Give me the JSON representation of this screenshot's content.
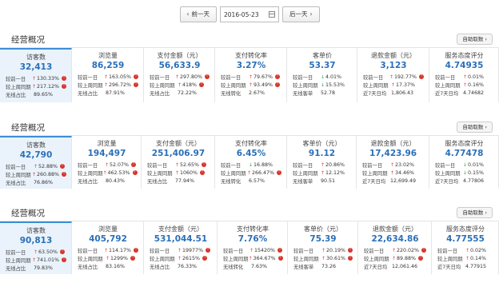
{
  "datebar": {
    "prev_label": "前一天",
    "date_value": "2016-05-23",
    "next_label": "后一天"
  },
  "sections": [
    {
      "title": "经营概况",
      "detail_label": "自助取数",
      "cards": [
        {
          "label": "访客数",
          "value": "32,413",
          "r1k": "较前一日",
          "r1v": "130.33%",
          "r1d": "up",
          "r1b": true,
          "r2k": "较上周同期",
          "r2v": "217.12%",
          "r2d": "up",
          "r2b": true,
          "r3k": "无线占比",
          "r3v": "89.65%"
        },
        {
          "label": "浏览量",
          "value": "86,259",
          "r1k": "较前一日",
          "r1v": "163.05%",
          "r1d": "up",
          "r1b": true,
          "r2k": "较上周同期",
          "r2v": "296.72%",
          "r2d": "up",
          "r2b": true,
          "r3k": "无线占比",
          "r3v": "87.91%"
        },
        {
          "label": "支付金额（元）",
          "value": "56,633.9",
          "r1k": "较前一日",
          "r1v": "297.80%",
          "r1d": "up",
          "r1b": true,
          "r2k": "较上周同期",
          "r2v": "418%",
          "r2d": "up",
          "r2b": true,
          "r3k": "无线占比",
          "r3v": "72.22%"
        },
        {
          "label": "支付转化率",
          "value": "3.27%",
          "r1k": "较前一日",
          "r1v": "79.67%",
          "r1d": "up",
          "r1b": true,
          "r2k": "较上周同期",
          "r2v": "93.49%",
          "r2d": "up",
          "r2b": true,
          "r3k": "无线转化",
          "r3v": "2.67%"
        },
        {
          "label": "客单价",
          "value": "53.37",
          "r1k": "较前一日",
          "r1v": "4.01%",
          "r1d": "down",
          "r1b": false,
          "r2k": "较上周同期",
          "r2v": "15.53%",
          "r2d": "down",
          "r2b": false,
          "r3k": "无线客单",
          "r3v": "52.78"
        },
        {
          "label": "退款金额（元）",
          "value": "3,123",
          "r1k": "较前一日",
          "r1v": "192.77%",
          "r1d": "up",
          "r1b": true,
          "r2k": "较上周同期",
          "r2v": "17.37%",
          "r2d": "up",
          "r2b": false,
          "r3k": "近7天日均",
          "r3v": "1,806.43"
        },
        {
          "label": "服务态度评分",
          "value": "4.74935",
          "r1k": "较前一日",
          "r1v": "0.01%",
          "r1d": "up",
          "r1b": false,
          "r2k": "较上周同期",
          "r2v": "0.16%",
          "r2d": "up",
          "r2b": false,
          "r3k": "近7天日均",
          "r3v": "4.74682"
        }
      ]
    },
    {
      "title": "经营概况",
      "detail_label": "自助取数",
      "cards": [
        {
          "label": "访客数",
          "value": "42,790",
          "r1k": "较前一日",
          "r1v": "52.88%",
          "r1d": "up",
          "r1b": true,
          "r2k": "较上周同期",
          "r2v": "260.88%",
          "r2d": "up",
          "r2b": true,
          "r3k": "无线占比",
          "r3v": "76.86%"
        },
        {
          "label": "浏览量",
          "value": "194,497",
          "r1k": "较前一日",
          "r1v": "52.07%",
          "r1d": "up",
          "r1b": true,
          "r2k": "较上周同期",
          "r2v": "462.53%",
          "r2d": "up",
          "r2b": true,
          "r3k": "无线占比",
          "r3v": "80.43%"
        },
        {
          "label": "支付金额（元）",
          "value": "251,406.97",
          "r1k": "较前一日",
          "r1v": "52.65%",
          "r1d": "up",
          "r1b": true,
          "r2k": "较上周同期",
          "r2v": "1060%",
          "r2d": "up",
          "r2b": true,
          "r3k": "无线占比",
          "r3v": "77.94%"
        },
        {
          "label": "支付转化率",
          "value": "6.45%",
          "r1k": "较前一日",
          "r1v": "16.88%",
          "r1d": "down",
          "r1b": false,
          "r2k": "较上周同期",
          "r2v": "266.47%",
          "r2d": "up",
          "r2b": true,
          "r3k": "无线转化",
          "r3v": "6.57%"
        },
        {
          "label": "客单价（元）",
          "value": "91.12",
          "r1k": "较前一日",
          "r1v": "20.86%",
          "r1d": "up",
          "r1b": false,
          "r2k": "较上周同期",
          "r2v": "12.12%",
          "r2d": "up",
          "r2b": false,
          "r3k": "无线客单",
          "r3v": "90.51"
        },
        {
          "label": "退款金额（元）",
          "value": "17,423.96",
          "r1k": "较前一日",
          "r1v": "23.02%",
          "r1d": "up",
          "r1b": false,
          "r2k": "较上周同期",
          "r2v": "34.46%",
          "r2d": "up",
          "r2b": false,
          "r3k": "近7天日均",
          "r3v": "12,699.49"
        },
        {
          "label": "服务态度评分",
          "value": "4.77478",
          "r1k": "较前一日",
          "r1v": "0.01%",
          "r1d": "down",
          "r1b": false,
          "r2k": "较上周同期",
          "r2v": "0.15%",
          "r2d": "down",
          "r2b": false,
          "r3k": "近7天日均",
          "r3v": "4.77806"
        }
      ]
    },
    {
      "title": "经营概况",
      "detail_label": "自助取数",
      "cards": [
        {
          "label": "访客数",
          "value": "90,813",
          "r1k": "较前一日",
          "r1v": "63.50%",
          "r1d": "up",
          "r1b": true,
          "r2k": "较上周同期",
          "r2v": "741.01%",
          "r2d": "up",
          "r2b": true,
          "r3k": "无线占比",
          "r3v": "79.83%"
        },
        {
          "label": "浏览量",
          "value": "405,792",
          "r1k": "较前一日",
          "r1v": "114.17%",
          "r1d": "up",
          "r1b": true,
          "r2k": "较上周同期",
          "r2v": "1299%",
          "r2d": "up",
          "r2b": true,
          "r3k": "无线占比",
          "r3v": "83.16%"
        },
        {
          "label": "支付金额（元）",
          "value": "531,044.51",
          "r1k": "较前一日",
          "r1v": "19977%",
          "r1d": "up",
          "r1b": true,
          "r2k": "较上周同期",
          "r2v": "2615%",
          "r2d": "up",
          "r2b": true,
          "r3k": "无线占比",
          "r3v": "76.33%"
        },
        {
          "label": "支付转化率",
          "value": "7.76%",
          "r1k": "较前一日",
          "r1v": "15420%",
          "r1d": "up",
          "r1b": true,
          "r2k": "较上周同期",
          "r2v": "364.67%",
          "r2d": "up",
          "r2b": true,
          "r3k": "无线转化",
          "r3v": "7.63%"
        },
        {
          "label": "客单价（元）",
          "value": "75.39",
          "r1k": "较前一日",
          "r1v": "20.19%",
          "r1d": "up",
          "r1b": true,
          "r2k": "较上周同期",
          "r2v": "30.61%",
          "r2d": "up",
          "r2b": true,
          "r3k": "无线客单",
          "r3v": "73.26"
        },
        {
          "label": "退款金额（元）",
          "value": "22,634.86",
          "r1k": "较前一日",
          "r1v": "220.02%",
          "r1d": "up",
          "r1b": true,
          "r2k": "较上周同期",
          "r2v": "89.88%",
          "r2d": "up",
          "r2b": true,
          "r3k": "近7天日均",
          "r3v": "12,061.46"
        },
        {
          "label": "服务态度评分",
          "value": "4.77555",
          "r1k": "较前一日",
          "r1v": "0.02%",
          "r1d": "up",
          "r1b": false,
          "r2k": "较上周同期",
          "r2v": "0.14%",
          "r2d": "up",
          "r2b": false,
          "r3k": "近7天日均",
          "r3v": "4.77915"
        }
      ]
    }
  ]
}
